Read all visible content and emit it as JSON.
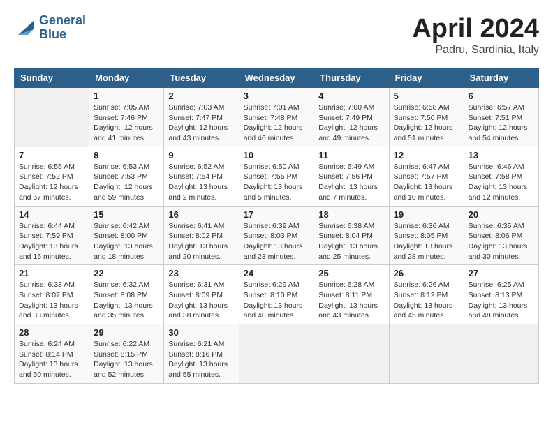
{
  "header": {
    "logo_line1": "General",
    "logo_line2": "Blue",
    "month_title": "April 2024",
    "location": "Padru, Sardinia, Italy"
  },
  "weekdays": [
    "Sunday",
    "Monday",
    "Tuesday",
    "Wednesday",
    "Thursday",
    "Friday",
    "Saturday"
  ],
  "weeks": [
    [
      {
        "day": "",
        "info": ""
      },
      {
        "day": "1",
        "info": "Sunrise: 7:05 AM\nSunset: 7:46 PM\nDaylight: 12 hours\nand 41 minutes."
      },
      {
        "day": "2",
        "info": "Sunrise: 7:03 AM\nSunset: 7:47 PM\nDaylight: 12 hours\nand 43 minutes."
      },
      {
        "day": "3",
        "info": "Sunrise: 7:01 AM\nSunset: 7:48 PM\nDaylight: 12 hours\nand 46 minutes."
      },
      {
        "day": "4",
        "info": "Sunrise: 7:00 AM\nSunset: 7:49 PM\nDaylight: 12 hours\nand 49 minutes."
      },
      {
        "day": "5",
        "info": "Sunrise: 6:58 AM\nSunset: 7:50 PM\nDaylight: 12 hours\nand 51 minutes."
      },
      {
        "day": "6",
        "info": "Sunrise: 6:57 AM\nSunset: 7:51 PM\nDaylight: 12 hours\nand 54 minutes."
      }
    ],
    [
      {
        "day": "7",
        "info": "Sunrise: 6:55 AM\nSunset: 7:52 PM\nDaylight: 12 hours\nand 57 minutes."
      },
      {
        "day": "8",
        "info": "Sunrise: 6:53 AM\nSunset: 7:53 PM\nDaylight: 12 hours\nand 59 minutes."
      },
      {
        "day": "9",
        "info": "Sunrise: 6:52 AM\nSunset: 7:54 PM\nDaylight: 13 hours\nand 2 minutes."
      },
      {
        "day": "10",
        "info": "Sunrise: 6:50 AM\nSunset: 7:55 PM\nDaylight: 13 hours\nand 5 minutes."
      },
      {
        "day": "11",
        "info": "Sunrise: 6:49 AM\nSunset: 7:56 PM\nDaylight: 13 hours\nand 7 minutes."
      },
      {
        "day": "12",
        "info": "Sunrise: 6:47 AM\nSunset: 7:57 PM\nDaylight: 13 hours\nand 10 minutes."
      },
      {
        "day": "13",
        "info": "Sunrise: 6:46 AM\nSunset: 7:58 PM\nDaylight: 13 hours\nand 12 minutes."
      }
    ],
    [
      {
        "day": "14",
        "info": "Sunrise: 6:44 AM\nSunset: 7:59 PM\nDaylight: 13 hours\nand 15 minutes."
      },
      {
        "day": "15",
        "info": "Sunrise: 6:42 AM\nSunset: 8:00 PM\nDaylight: 13 hours\nand 18 minutes."
      },
      {
        "day": "16",
        "info": "Sunrise: 6:41 AM\nSunset: 8:02 PM\nDaylight: 13 hours\nand 20 minutes."
      },
      {
        "day": "17",
        "info": "Sunrise: 6:39 AM\nSunset: 8:03 PM\nDaylight: 13 hours\nand 23 minutes."
      },
      {
        "day": "18",
        "info": "Sunrise: 6:38 AM\nSunset: 8:04 PM\nDaylight: 13 hours\nand 25 minutes."
      },
      {
        "day": "19",
        "info": "Sunrise: 6:36 AM\nSunset: 8:05 PM\nDaylight: 13 hours\nand 28 minutes."
      },
      {
        "day": "20",
        "info": "Sunrise: 6:35 AM\nSunset: 8:06 PM\nDaylight: 13 hours\nand 30 minutes."
      }
    ],
    [
      {
        "day": "21",
        "info": "Sunrise: 6:33 AM\nSunset: 8:07 PM\nDaylight: 13 hours\nand 33 minutes."
      },
      {
        "day": "22",
        "info": "Sunrise: 6:32 AM\nSunset: 8:08 PM\nDaylight: 13 hours\nand 35 minutes."
      },
      {
        "day": "23",
        "info": "Sunrise: 6:31 AM\nSunset: 8:09 PM\nDaylight: 13 hours\nand 38 minutes."
      },
      {
        "day": "24",
        "info": "Sunrise: 6:29 AM\nSunset: 8:10 PM\nDaylight: 13 hours\nand 40 minutes."
      },
      {
        "day": "25",
        "info": "Sunrise: 6:28 AM\nSunset: 8:11 PM\nDaylight: 13 hours\nand 43 minutes."
      },
      {
        "day": "26",
        "info": "Sunrise: 6:26 AM\nSunset: 8:12 PM\nDaylight: 13 hours\nand 45 minutes."
      },
      {
        "day": "27",
        "info": "Sunrise: 6:25 AM\nSunset: 8:13 PM\nDaylight: 13 hours\nand 48 minutes."
      }
    ],
    [
      {
        "day": "28",
        "info": "Sunrise: 6:24 AM\nSunset: 8:14 PM\nDaylight: 13 hours\nand 50 minutes."
      },
      {
        "day": "29",
        "info": "Sunrise: 6:22 AM\nSunset: 8:15 PM\nDaylight: 13 hours\nand 52 minutes."
      },
      {
        "day": "30",
        "info": "Sunrise: 6:21 AM\nSunset: 8:16 PM\nDaylight: 13 hours\nand 55 minutes."
      },
      {
        "day": "",
        "info": ""
      },
      {
        "day": "",
        "info": ""
      },
      {
        "day": "",
        "info": ""
      },
      {
        "day": "",
        "info": ""
      }
    ]
  ]
}
